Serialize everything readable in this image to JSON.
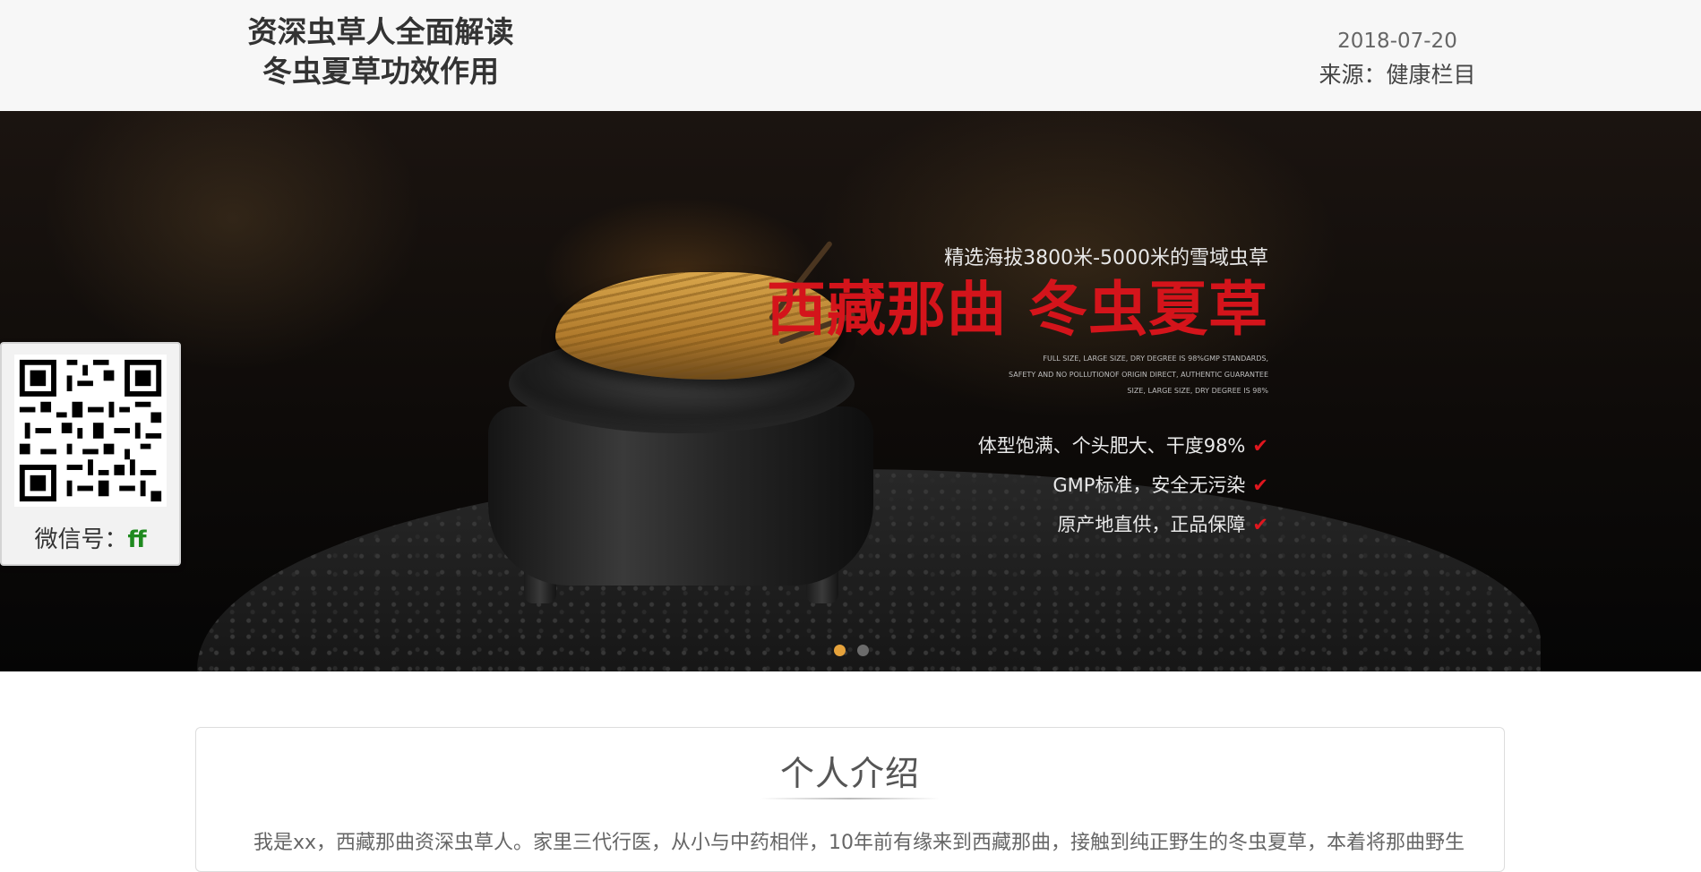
{
  "header": {
    "title_line1": "资深虫草人全面解读",
    "title_line2": "冬虫夏草功效作用",
    "date": "2018-07-20",
    "source": "来源：健康栏目"
  },
  "banner": {
    "subtitle": "精选海拔3800米-5000米的雪域虫草",
    "headline": "西藏那曲 冬虫夏草",
    "english_line1": "FULL SIZE, LARGE SIZE, DRY DEGREE IS 98%GMP STANDARDS,",
    "english_line2": "SAFETY AND NO POLLUTIONOF ORIGIN DIRECT, AUTHENTIC GUARANTEE",
    "english_line3": "SIZE, LARGE SIZE, DRY DEGREE IS 98%",
    "features": [
      "体型饱满、个头肥大、干度98%",
      "GMP标准，安全无污染",
      "原产地直供，正品保障"
    ],
    "check_icon": "✔",
    "carousel_dots": {
      "count": 2,
      "active_index": 0
    },
    "colors": {
      "headline": "#d4141b",
      "dot_active": "#e5a23b"
    }
  },
  "wechat": {
    "label": "微信号：",
    "id": "ff",
    "qr_icon": "qr-code-icon"
  },
  "intro": {
    "title": "个人介绍",
    "text": "我是xx，西藏那曲资深虫草人。家里三代行医，从小与中药相伴，10年前有缘来到西藏那曲，接触到纯正野生的冬虫夏草，本着将那曲野生"
  }
}
